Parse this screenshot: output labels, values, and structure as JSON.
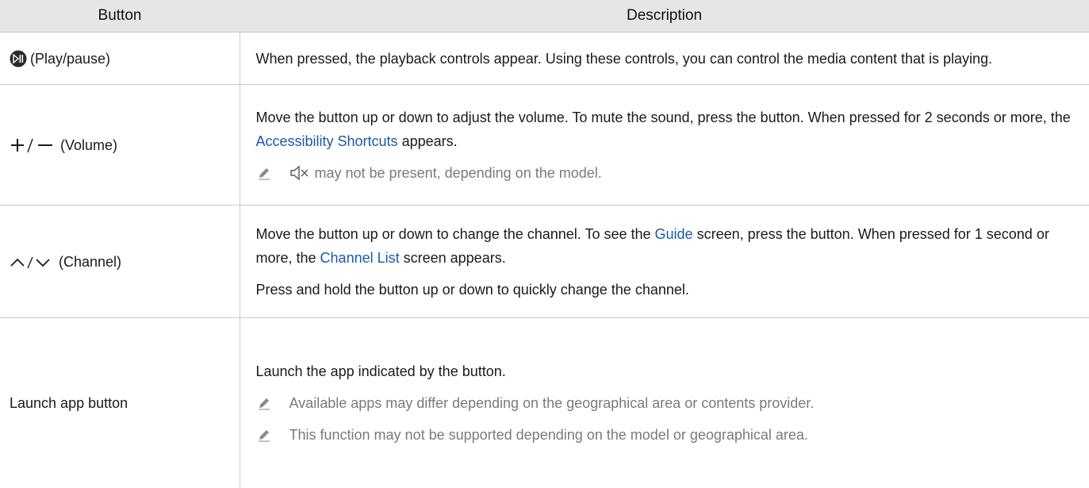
{
  "header": {
    "col1": "Button",
    "col2": "Description"
  },
  "rows": [
    {
      "name": "(Play/pause)",
      "icon": "play-pause-icon",
      "desc1": "When pressed, the playback controls appear. Using these controls, you can control the media content that is playing."
    },
    {
      "name": "(Volume)",
      "icon": "plus-minus-icon",
      "desc1_a": "Move the button up or down to adjust the volume. To mute the sound, press the button. When pressed for 2 seconds or more, the ",
      "desc1_link": "Accessibility Shortcuts",
      "desc1_b": " appears.",
      "note_icon": "mute-speaker-icon",
      "note": " may not be present, depending on the model."
    },
    {
      "name": "(Channel)",
      "icon": "up-down-chevron-icon",
      "desc1_a": "Move the button up or down to change the channel. To see the ",
      "desc1_link1": "Guide",
      "desc1_b": " screen, press the button. When pressed for 1 second or more, the ",
      "desc1_link2": "Channel List",
      "desc1_c": " screen appears.",
      "desc2": "Press and hold the button up or down to quickly change the channel."
    },
    {
      "name": "Launch app button",
      "desc1": "Launch the app indicated by the button.",
      "note1": "Available apps may differ depending on the geographical area or contents provider.",
      "note2": "This function may not be supported depending on the model or geographical area."
    }
  ],
  "colors": {
    "header_bg": "#e6e6e6",
    "link": "#1a5aa6",
    "note_text": "#7a7a7a",
    "border": "#c8c8c8"
  }
}
